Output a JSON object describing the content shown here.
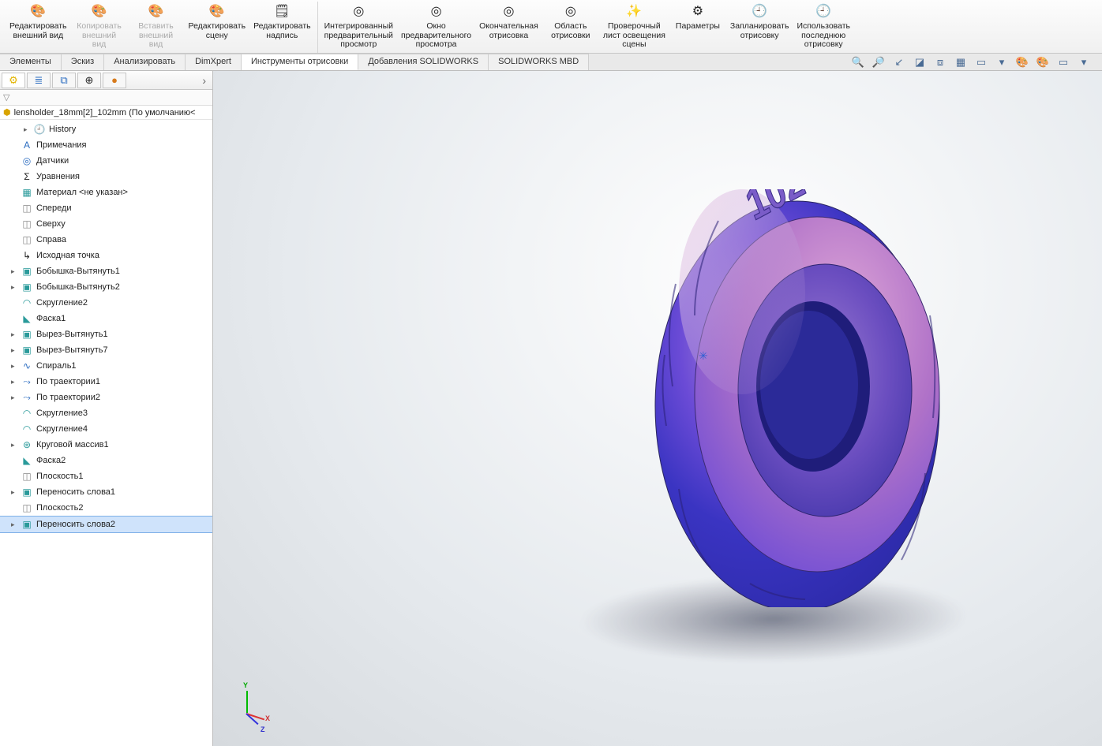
{
  "ribbon": {
    "groups": [
      {
        "items": [
          {
            "label": "Редактировать\nвнешний вид",
            "icon": "🎨",
            "key": "edit-appearance",
            "disabled": false
          },
          {
            "label": "Копировать\nвнешний\nвид",
            "icon": "🎨",
            "key": "copy-appearance",
            "disabled": true
          },
          {
            "label": "Вставить\nвнешний\nвид",
            "icon": "🎨",
            "key": "paste-appearance",
            "disabled": true
          },
          {
            "label": "Редактировать\nсцену",
            "icon": "🎨",
            "key": "edit-scene",
            "disabled": false
          },
          {
            "label": "Редактировать\nнадпись",
            "icon": "🗒",
            "key": "edit-decal",
            "disabled": false
          }
        ]
      },
      {
        "items": [
          {
            "label": "Интегрированный\nпредварительный\nпросмотр",
            "icon": "◎",
            "key": "integrated-preview",
            "disabled": false
          },
          {
            "label": "Окно\nпредварительного\nпросмотра",
            "icon": "◎",
            "key": "preview-window",
            "disabled": false
          },
          {
            "label": "Окончательная\nотрисовка",
            "icon": "◎",
            "key": "final-render",
            "disabled": false
          },
          {
            "label": "Область\nотрисовки",
            "icon": "◎",
            "key": "render-region",
            "disabled": false
          },
          {
            "label": "Проверочный\nлист освещения\nсцены",
            "icon": "✨",
            "key": "light-check",
            "disabled": false
          },
          {
            "label": "Параметры",
            "icon": "⚙",
            "key": "options",
            "disabled": false
          },
          {
            "label": "Запланировать\nотрисовку",
            "icon": "🕘",
            "key": "schedule-render",
            "disabled": false
          },
          {
            "label": "Использовать\nпоследнюю\nотрисовку",
            "icon": "🕘",
            "key": "use-last-render",
            "disabled": false
          }
        ]
      }
    ]
  },
  "tabs": [
    {
      "label": "Элементы",
      "key": "features"
    },
    {
      "label": "Эскиз",
      "key": "sketch"
    },
    {
      "label": "Анализировать",
      "key": "evaluate"
    },
    {
      "label": "DimXpert",
      "key": "dimxpert"
    },
    {
      "label": "Инструменты отрисовки",
      "key": "render-tools",
      "active": true
    },
    {
      "label": "Добавления SOLIDWORKS",
      "key": "addins"
    },
    {
      "label": "SOLIDWORKS MBD",
      "key": "mbd"
    }
  ],
  "viewtools": [
    {
      "key": "zoom-fit",
      "glyph": "🔍"
    },
    {
      "key": "zoom-area",
      "glyph": "🔎"
    },
    {
      "key": "prev-view",
      "glyph": "↙"
    },
    {
      "key": "section",
      "glyph": "◪"
    },
    {
      "key": "view-orient",
      "glyph": "⧈"
    },
    {
      "key": "display-style",
      "glyph": "▦"
    },
    {
      "key": "hide-show",
      "glyph": "▭"
    },
    {
      "key": "sep1",
      "glyph": "▾"
    },
    {
      "key": "edit-appearance",
      "glyph": "🎨"
    },
    {
      "key": "apply-scene",
      "glyph": "🎨"
    },
    {
      "key": "view-settings",
      "glyph": "▭"
    },
    {
      "key": "sep2",
      "glyph": "▾"
    }
  ],
  "fm_tabs": [
    {
      "key": "feature-manager",
      "glyph": "⚙",
      "color": "c-yellow",
      "active": true
    },
    {
      "key": "property-manager",
      "glyph": "≣",
      "color": "c-blue"
    },
    {
      "key": "config-manager",
      "glyph": "⧉",
      "color": "c-blue"
    },
    {
      "key": "dimxpert-manager",
      "glyph": "⊕",
      "color": ""
    },
    {
      "key": "display-manager",
      "glyph": "●",
      "color": "c-orange"
    }
  ],
  "root_name": "lensholder_18mm[2]_102mm  (По умолчанию<",
  "tree": [
    {
      "label": "History",
      "icon": "🕘",
      "child": true,
      "color": "c-blue",
      "exp": true
    },
    {
      "label": "Примечания",
      "icon": "A",
      "child": false,
      "color": "c-blue"
    },
    {
      "label": "Датчики",
      "icon": "◎",
      "child": false,
      "color": "c-blue"
    },
    {
      "label": "Уравнения",
      "icon": "Σ",
      "child": false,
      "color": ""
    },
    {
      "label": "Материал <не указан>",
      "icon": "▦",
      "child": false,
      "color": "c-teal"
    },
    {
      "label": "Спереди",
      "icon": "◫",
      "child": false,
      "color": "c-gray"
    },
    {
      "label": "Сверху",
      "icon": "◫",
      "child": false,
      "color": "c-gray"
    },
    {
      "label": "Справа",
      "icon": "◫",
      "child": false,
      "color": "c-gray"
    },
    {
      "label": "Исходная точка",
      "icon": "↳",
      "child": false,
      "color": ""
    },
    {
      "label": "Бобышка-Вытянуть1",
      "icon": "▣",
      "child": false,
      "color": "c-teal",
      "exp": true
    },
    {
      "label": "Бобышка-Вытянуть2",
      "icon": "▣",
      "child": false,
      "color": "c-teal",
      "exp": true
    },
    {
      "label": "Скругление2",
      "icon": "◠",
      "child": false,
      "color": "c-teal"
    },
    {
      "label": "Фаска1",
      "icon": "◣",
      "child": false,
      "color": "c-teal"
    },
    {
      "label": "Вырез-Вытянуть1",
      "icon": "▣",
      "child": false,
      "color": "c-teal",
      "exp": true
    },
    {
      "label": "Вырез-Вытянуть7",
      "icon": "▣",
      "child": false,
      "color": "c-teal",
      "exp": true
    },
    {
      "label": "Спираль1",
      "icon": "∿",
      "child": false,
      "color": "c-blue",
      "exp": true
    },
    {
      "label": "По траектории1",
      "icon": "⤳",
      "child": false,
      "color": "c-blue",
      "exp": true
    },
    {
      "label": "По траектории2",
      "icon": "⤳",
      "child": false,
      "color": "c-blue",
      "exp": true
    },
    {
      "label": "Скругление3",
      "icon": "◠",
      "child": false,
      "color": "c-teal"
    },
    {
      "label": "Скругление4",
      "icon": "◠",
      "child": false,
      "color": "c-teal"
    },
    {
      "label": "Круговой массив1",
      "icon": "⊛",
      "child": false,
      "color": "c-teal",
      "exp": true
    },
    {
      "label": "Фаска2",
      "icon": "◣",
      "child": false,
      "color": "c-teal"
    },
    {
      "label": "Плоскость1",
      "icon": "◫",
      "child": false,
      "color": "c-gray"
    },
    {
      "label": "Переносить слова1",
      "icon": "▣",
      "child": false,
      "color": "c-teal",
      "exp": true
    },
    {
      "label": "Плоскость2",
      "icon": "◫",
      "child": false,
      "color": "c-gray"
    },
    {
      "label": "Переносить слова2",
      "icon": "▣",
      "child": false,
      "color": "c-teal",
      "exp": true,
      "selected": true
    }
  ],
  "triad": {
    "x": "X",
    "y": "Y",
    "z": "Z"
  }
}
